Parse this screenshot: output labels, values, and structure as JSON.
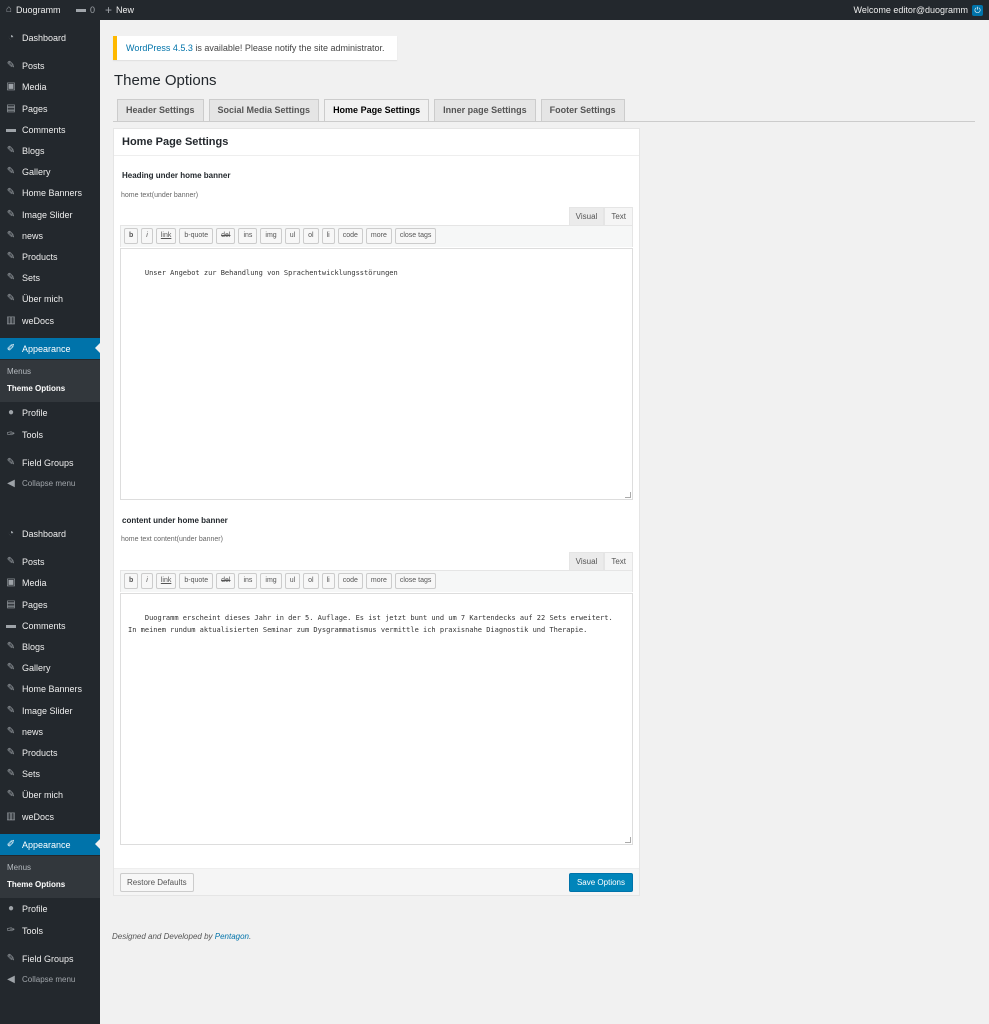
{
  "adminbar": {
    "site_name": "Duogramm",
    "comments_count": "0",
    "new_label": "New",
    "welcome": "Welcome editor@duogramm"
  },
  "sidebar": {
    "items": [
      {
        "label": "Dashboard",
        "icon": "dashboard-icon"
      },
      {
        "label": "Posts",
        "icon": "pin-icon"
      },
      {
        "label": "Media",
        "icon": "media-icon"
      },
      {
        "label": "Pages",
        "icon": "page-icon"
      },
      {
        "label": "Comments",
        "icon": "comment-icon"
      },
      {
        "label": "Blogs",
        "icon": "pin-icon"
      },
      {
        "label": "Gallery",
        "icon": "pin-icon"
      },
      {
        "label": "Home Banners",
        "icon": "pin-icon"
      },
      {
        "label": "Image Slider",
        "icon": "pin-icon"
      },
      {
        "label": "news",
        "icon": "pin-icon"
      },
      {
        "label": "Products",
        "icon": "pin-icon"
      },
      {
        "label": "Sets",
        "icon": "pin-icon"
      },
      {
        "label": "Über mich",
        "icon": "pin-icon"
      },
      {
        "label": "weDocs",
        "icon": "doc-icon"
      },
      {
        "label": "Appearance",
        "icon": "brush-icon"
      },
      {
        "label": "Profile",
        "icon": "user-icon"
      },
      {
        "label": "Tools",
        "icon": "wrench-icon"
      },
      {
        "label": "Field Groups",
        "icon": "pin-icon"
      }
    ],
    "submenu": {
      "menus": "Menus",
      "theme_options": "Theme Options"
    },
    "collapse": "Collapse menu"
  },
  "notice": {
    "link": "WordPress 4.5.3",
    "text": " is available! Please notify the site administrator."
  },
  "page_title": "Theme Options",
  "tabs": [
    "Header Settings",
    "Social Media Settings",
    "Home Page Settings",
    "Inner page Settings",
    "Footer Settings"
  ],
  "panel": {
    "title": "Home Page Settings",
    "fields": [
      {
        "label": "Heading under home banner",
        "desc": "home text(under banner)",
        "content": "Unser Angebot zur Behandlung von Sprachentwicklungsstörungen"
      },
      {
        "label": "content under home banner",
        "desc": "home text content(under banner)",
        "content": "Duogramm erscheint dieses Jahr in der 5. Auflage. Es ist jetzt bunt und um 7 Kartendecks auf 22 Sets erweitert.\nIn meinem rundum aktualisierten Seminar zum Dysgrammatismus vermittle ich praxisnahe Diagnostik und Therapie."
      }
    ],
    "mode_tabs": [
      "Visual",
      "Text"
    ],
    "toolbar": [
      "b",
      "i",
      "link",
      "b-quote",
      "del",
      "ins",
      "img",
      "ul",
      "ol",
      "li",
      "code",
      "more",
      "close tags"
    ],
    "restore_label": "Restore Defaults",
    "save_label": "Save Options"
  },
  "footer": {
    "text": "Designed and Developed by ",
    "link": "Pentagon",
    "suffix": "."
  }
}
